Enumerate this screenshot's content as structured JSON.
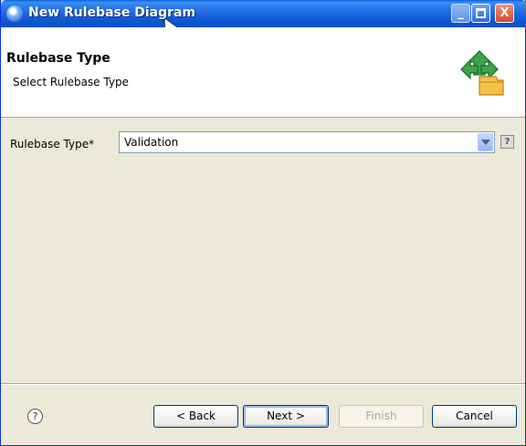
{
  "window": {
    "title": "New Rulebase Diagram"
  },
  "header": {
    "title": "Rulebase Type",
    "subtitle": "Select Rulebase Type"
  },
  "form": {
    "rulebase_type": {
      "label": "Rulebase Type*",
      "value": "Validation"
    },
    "help_glyph": "?"
  },
  "footer": {
    "help_glyph": "?",
    "back_label": "< Back",
    "next_label": "Next >",
    "finish_label": "Finish",
    "cancel_label": "Cancel"
  },
  "titlebar_buttons": {
    "minimize": "_",
    "close": "X"
  },
  "icons": [
    "app-icon",
    "cursor-icon",
    "wizard-icon",
    "chevron-down-icon",
    "help-icon"
  ],
  "colors": {
    "titlebar": "#0b5ad6",
    "dialog_bg": "#ece9d8",
    "button_border": "#003c74",
    "combo_border": "#7f9db9"
  }
}
